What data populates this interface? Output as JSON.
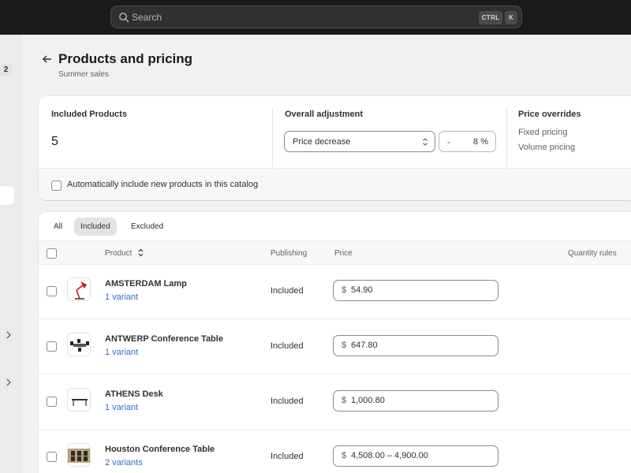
{
  "search": {
    "placeholder": "Search",
    "shortcut_ctrl": "CTRL",
    "shortcut_key": "K"
  },
  "sidebar": {
    "badge": "2"
  },
  "header": {
    "title": "Products and pricing",
    "subtitle": "Summer sales"
  },
  "summary": {
    "included_title": "Included Products",
    "included_count": "5",
    "adjustment_title": "Overall adjustment",
    "adjustment_select": "Price decrease",
    "adjustment_sign": "-",
    "adjustment_value": "8",
    "adjustment_unit": "%",
    "overrides_title": "Price overrides",
    "overrides_items": [
      "Fixed pricing",
      "Volume pricing"
    ],
    "auto_include_label": "Automatically include new products in this catalog"
  },
  "tabs": [
    {
      "label": "All",
      "active": false
    },
    {
      "label": "Included",
      "active": true
    },
    {
      "label": "Excluded",
      "active": false
    }
  ],
  "table": {
    "columns": {
      "product": "Product",
      "publishing": "Publishing",
      "price": "Price",
      "quantity_rules": "Quantity rules"
    },
    "rows": [
      {
        "name": "AMSTERDAM Lamp",
        "variants": "1 variant",
        "publishing": "Included",
        "currency": "$",
        "price": "54.90",
        "thumb": "lamp-icon"
      },
      {
        "name": "ANTWERP Conference Table",
        "variants": "1 variant",
        "publishing": "Included",
        "currency": "$",
        "price": "647.80",
        "thumb": "conference-table-icon"
      },
      {
        "name": "ATHENS Desk",
        "variants": "1 variant",
        "publishing": "Included",
        "currency": "$",
        "price": "1,000.80",
        "thumb": "desk-icon"
      },
      {
        "name": "Houston Conference Table",
        "variants": "2 variants",
        "publishing": "Included",
        "currency": "$",
        "price": "4,508.00 – 4,900.00",
        "thumb": "conference-table-icon"
      }
    ]
  },
  "colors": {
    "topbar": "#1a1a1a",
    "background": "#f1f1f1",
    "link": "#2c6ecb",
    "card": "#ffffff"
  }
}
